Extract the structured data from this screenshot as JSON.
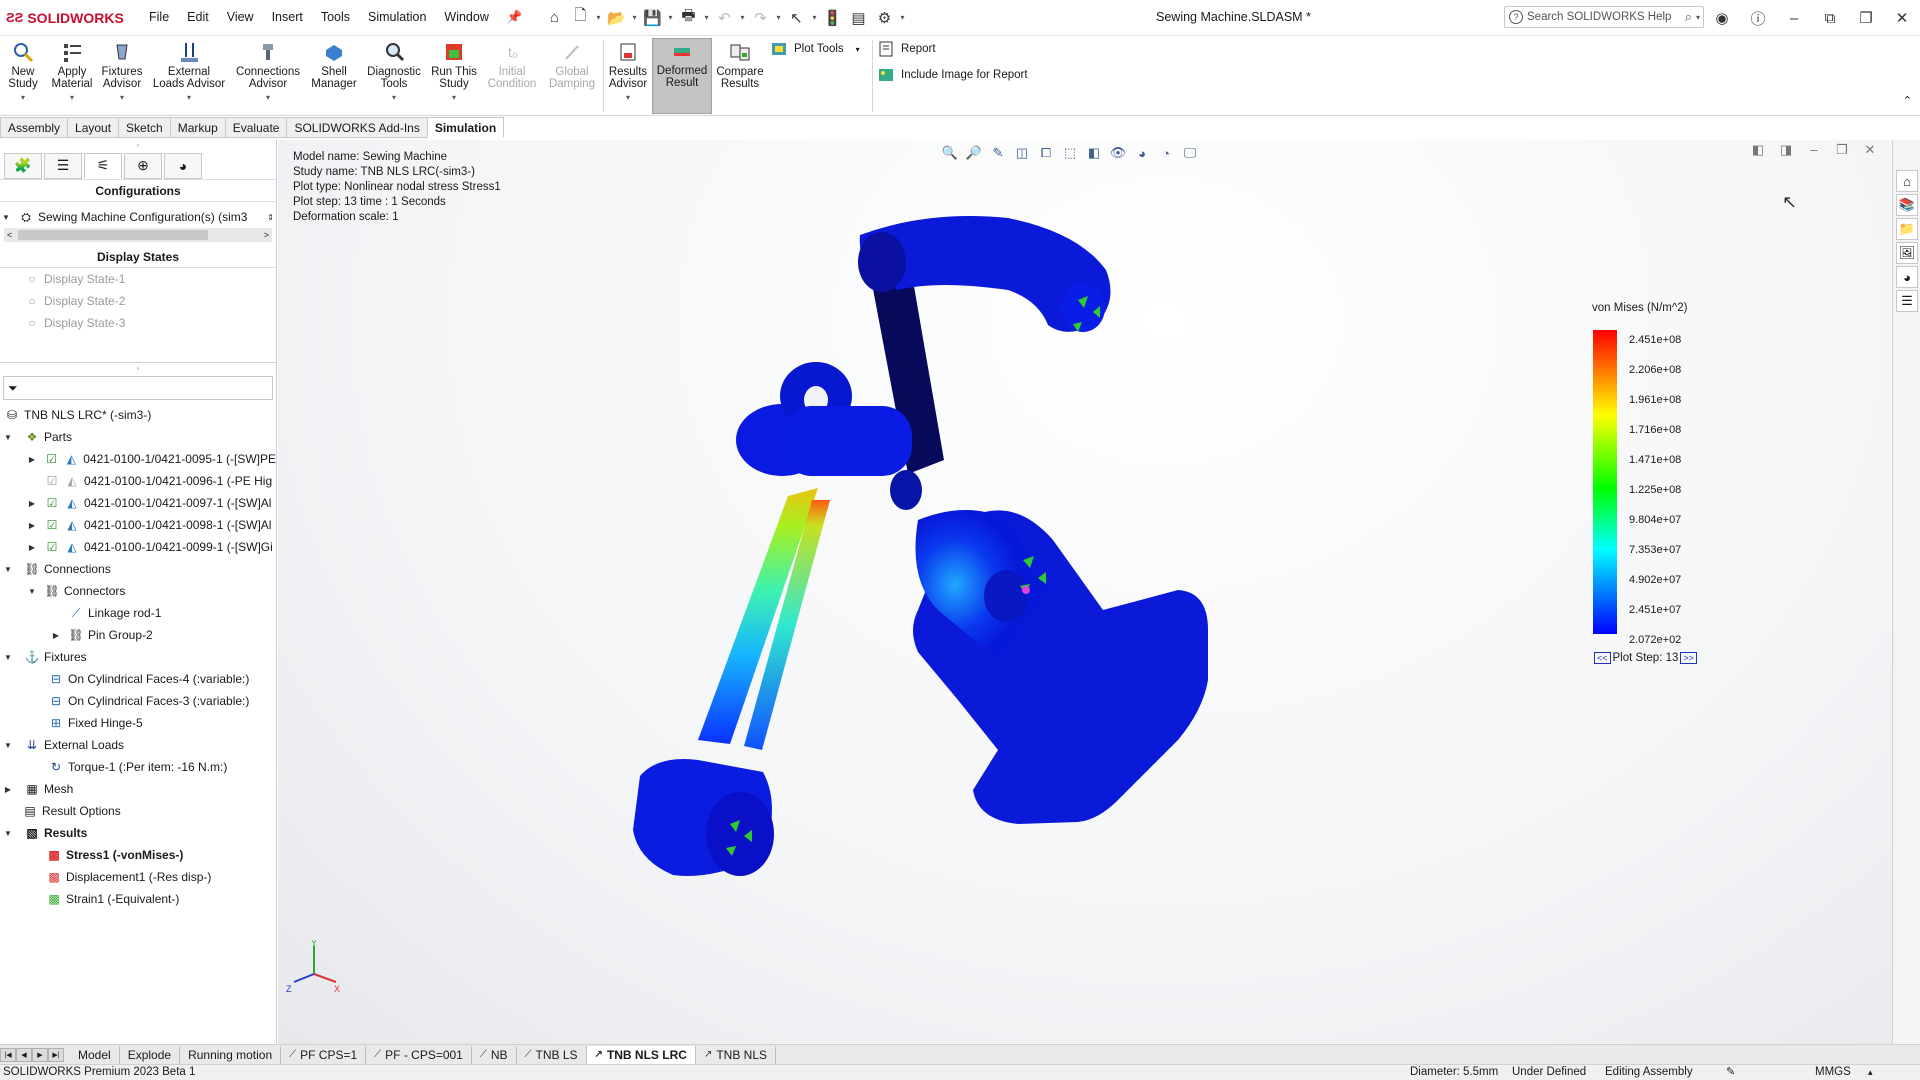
{
  "app": {
    "brand": "SOLIDWORKS",
    "doc_title": "Sewing Machine.SLDASM *",
    "search_placeholder": "Search SOLIDWORKS Help"
  },
  "menu": [
    "File",
    "Edit",
    "View",
    "Insert",
    "Tools",
    "Simulation",
    "Window"
  ],
  "ribbon": {
    "new_study": "New Study",
    "apply_material": "Apply Material",
    "fixtures_advisor": "Fixtures Advisor",
    "external_loads_advisor": "External Loads Advisor",
    "connections_advisor": "Connections Advisor",
    "shell_manager": "Shell Manager",
    "diagnostic_tools": "Diagnostic Tools",
    "run_this_study": "Run This Study",
    "initial_condition": "Initial Condition",
    "global_damping": "Global Damping",
    "results_advisor": "Results Advisor",
    "deformed_result": "Deformed Result",
    "compare_results": "Compare Results",
    "plot_tools": "Plot Tools",
    "report": "Report",
    "include_image": "Include Image for Report"
  },
  "tabs": [
    "Assembly",
    "Layout",
    "Sketch",
    "Markup",
    "Evaluate",
    "SOLIDWORKS Add-Ins",
    "Simulation"
  ],
  "left_panel": {
    "configurations_title": "Configurations",
    "config_item": "Sewing Machine Configuration(s)  (sim3",
    "display_states_title": "Display States",
    "display_states": [
      "Display State-1",
      "Display State-2",
      "Display State-3"
    ],
    "study": "TNB NLS LRC* (-sim3-)",
    "parts_label": "Parts",
    "parts": [
      "0421-0100-1/0421-0095-1 (-[SW]PE",
      "0421-0100-1/0421-0096-1 (-PE Hig",
      "0421-0100-1/0421-0097-1 (-[SW]Al",
      "0421-0100-1/0421-0098-1 (-[SW]Al",
      "0421-0100-1/0421-0099-1 (-[SW]Gi"
    ],
    "connections": "Connections",
    "connectors": "Connectors",
    "linkage_rod": "Linkage rod-1",
    "pin_group": "Pin Group-2",
    "fixtures": "Fixtures",
    "fixture_items": [
      "On Cylindrical Faces-4 (:variable:)",
      "On Cylindrical Faces-3 (:variable:)",
      "Fixed Hinge-5"
    ],
    "external_loads": "External Loads",
    "torque": "Torque-1 (:Per item: -16 N.m:)",
    "mesh": "Mesh",
    "result_options": "Result Options",
    "results": "Results",
    "result_items": [
      "Stress1 (-vonMises-)",
      "Displacement1 (-Res disp-)",
      "Strain1 (-Equivalent-)"
    ]
  },
  "viewport": {
    "info": {
      "model_name": "Model name: Sewing Machine",
      "study_name": "Study name: TNB NLS LRC(-sim3-)",
      "plot_type": "Plot type: Nonlinear nodal stress Stress1",
      "plot_step": "Plot step: 13   time : 1 Seconds",
      "deformation": "Deformation scale: 1"
    },
    "legend": {
      "title": "von Mises (N/m^2)",
      "ticks": [
        "2.451e+08",
        "2.206e+08",
        "1.961e+08",
        "1.716e+08",
        "1.471e+08",
        "1.225e+08",
        "9.804e+07",
        "7.353e+07",
        "4.902e+07",
        "2.451e+07",
        "2.072e+02"
      ],
      "plot_step": "Plot Step: 13",
      "prev": "<<",
      "next": ">>"
    },
    "triad": {
      "x": "X",
      "y": "Y",
      "z": "Z"
    }
  },
  "bottom_tabs": [
    "Model",
    "Explode",
    "Running motion",
    "PF CPS=1",
    "PF - CPS=001",
    "NB",
    "TNB LS",
    "TNB NLS LRC",
    "TNB NLS"
  ],
  "status": {
    "product": "SOLIDWORKS Premium 2023 Beta 1",
    "diameter": "Diameter: 5.5mm",
    "under_defined": "Under Defined",
    "editing": "Editing Assembly",
    "units": "MMGS"
  },
  "colors": {
    "brand_red": "#c8102e",
    "model_blue": "#0a14d6",
    "active_tab": "#c4c4c4"
  }
}
